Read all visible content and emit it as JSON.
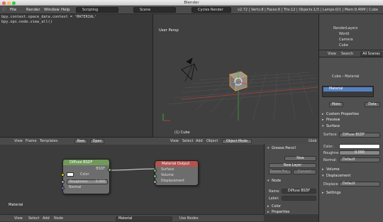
{
  "window": {
    "title": "Blender"
  },
  "infobar": {
    "menus": [
      "File",
      "Render",
      "Window",
      "Help"
    ],
    "layout": "Scripting",
    "scene": "Scene",
    "engine": "Cycles Render",
    "stats": "v2.72 | Verts:8 | Faces:6 | Tris:12 | Objects:1/3 | Lamps:0/1 | Mem:9.46M | Cube"
  },
  "console": {
    "lines": [
      "bpy.context.space_data.context = 'MATERIAL'",
      "bpy.ops.node.view_all()"
    ]
  },
  "viewport": {
    "label": "User Persp",
    "object_label": "(1) Cube",
    "header": {
      "view": "View",
      "select": "Select",
      "add": "Add",
      "object": "Object",
      "mode": "Object Mode",
      "global": "Glob"
    }
  },
  "outliner": {
    "items": [
      "RenderLayers",
      "World",
      "Camera",
      "Cube"
    ],
    "header": {
      "view": "View",
      "search": "Search",
      "scenes": "All Scenes"
    }
  },
  "properties": {
    "breadcrumb": [
      "Cube",
      "Material"
    ],
    "material_slot": "Material",
    "mat_field": "Mate",
    "data_label": "Data",
    "panels": [
      "Custom Properties",
      "Preview",
      "Surface",
      "Volume",
      "Displacement",
      "Settings"
    ],
    "surface_label": "Surface:",
    "surface_value": "Diffuse BSDF",
    "color_label": "Color:",
    "roughness_label": "Roughne:",
    "roughness_value": "0.000",
    "normal_label": "Normal:",
    "normal_value": "Default",
    "displace_label": "Displace:",
    "displace_value": "Default",
    "colors": {
      "color_swatch": "#ffffff",
      "highlight": "#5680c2"
    }
  },
  "node_editor": {
    "label": "Material",
    "header": {
      "view": "View",
      "select": "Select",
      "add": "Add",
      "node": "Node",
      "material": "Material",
      "use_nodes": "Use Nodes"
    },
    "top_header": {
      "view": "View",
      "frame": "Frame",
      "templates": "Templates",
      "new": "New",
      "open": "Open"
    },
    "diffuse": {
      "title": "Diffuse BSDF",
      "out": "BSDF",
      "color": "Color",
      "roughness_label": "Roughness:",
      "roughness_value": "0.000",
      "normal": "Normal"
    },
    "output": {
      "title": "Material Output",
      "surface": "Surface",
      "volume": "Volume",
      "displacement": "Displacement"
    },
    "colors": {
      "shader_header": "#6f9a5a",
      "output_header": "#b5514e",
      "socket_shader": "#63c763",
      "socket_color": "#c7c729",
      "socket_value": "#a1a1a1",
      "socket_vector": "#6363c7"
    }
  },
  "node_side": {
    "grease_pencil": "Grease Pencil",
    "new": "New",
    "new_layer": "New Layer",
    "delete_frame": "Delete Fra...",
    "convert": "Convert",
    "node_panel": "Node",
    "name_label": "Name:",
    "name_value": "Diffuse BSDF",
    "label_label": "Label:",
    "color_panel": "Color",
    "properties_panel": "Properties"
  }
}
